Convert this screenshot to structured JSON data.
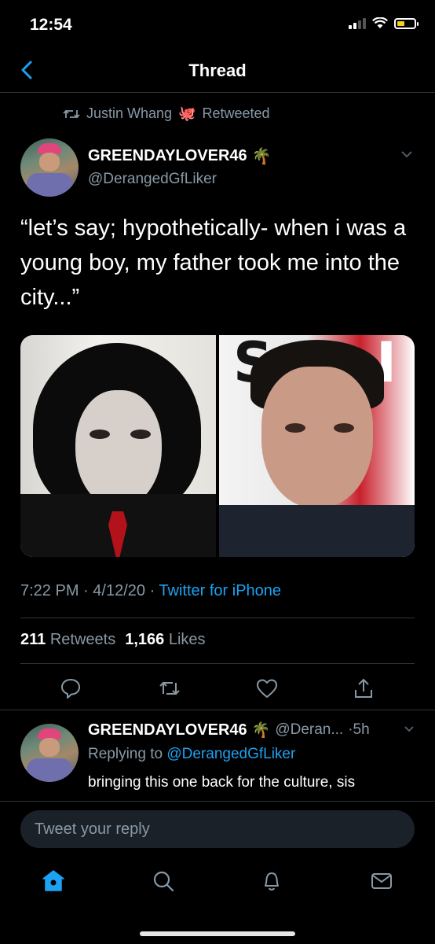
{
  "status_bar": {
    "time": "12:54"
  },
  "nav": {
    "title": "Thread"
  },
  "retweet_context": {
    "name": "Justin Whang",
    "suffix": "Retweeted",
    "emoji": "🐙"
  },
  "tweet": {
    "author_name": "GREENDAYLOVER46",
    "author_emoji": "🌴",
    "handle": "@DerangedGfLiker",
    "text": "“let’s say; hypothetically- when i was a young boy, my father took me into the city...”",
    "time": "7:22 PM",
    "date": "4/12/20",
    "source": "Twitter for iPhone",
    "retweets": "211",
    "retweets_label": "Retweets",
    "likes": "1,166",
    "likes_label": "Likes"
  },
  "reply": {
    "author_name": "GREENDAYLOVER46",
    "author_emoji": "🌴",
    "handle": "@Deran...",
    "age": "·5h",
    "replying_prefix": "Replying to",
    "replying_to": "@DerangedGfLiker",
    "text": "bringing this one back for the culture, sis"
  },
  "composer": {
    "placeholder": "Tweet your reply"
  },
  "colors": {
    "accent": "#1da1f2",
    "muted": "#8899a6",
    "divider": "#2f3336",
    "background": "#000000"
  },
  "icons": [
    "back-chevron-icon",
    "retweet-icon",
    "reply-icon",
    "like-icon",
    "share-icon",
    "home-icon",
    "search-icon",
    "notifications-icon",
    "messages-icon"
  ]
}
